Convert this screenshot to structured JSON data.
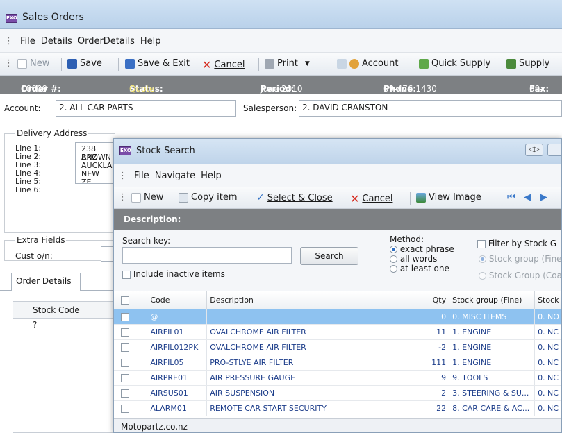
{
  "main": {
    "title": "Sales Orders",
    "app_icon_text": "EXO",
    "menu": [
      "File",
      "Details",
      "OrderDetails",
      "Help"
    ],
    "toolbar": {
      "new": "New",
      "save": "Save",
      "save_exit": "Save & Exit",
      "cancel": "Cancel",
      "print": "Print",
      "account": "Account",
      "quick_supply": "Quick Supply",
      "supply": "Supply"
    },
    "status": {
      "order_label": "Order #:",
      "order_value": "10009",
      "status_label": "Status:",
      "status_value": "Quote",
      "period_label": "Period:",
      "period_value": "June 2010",
      "phone_label": "Phone:",
      "phone_value": "09-476 1430",
      "fax_label": "Fax:",
      "fax_value": "09-"
    },
    "account_label": "Account:",
    "account_value": "2. ALL CAR PARTS",
    "salesperson_label": "Salesperson:",
    "salesperson_value": "2. DAVID CRANSTON",
    "delivery_title": "Delivery Address",
    "delivery_lines": {
      "l1": "Line 1:",
      "l2": "Line 2:",
      "l3": "Line 3:",
      "l4": "Line 4:",
      "l5": "Line 5:",
      "l6": "Line 6:",
      "v1": "238 ANZ",
      "v2": "BROWN",
      "v3": "AUCKLA",
      "v4": "NEW ZE"
    },
    "extra_title": "Extra Fields",
    "cust_label": "Cust o/n:",
    "tab_order_details": "Order Details",
    "grid_header": "Stock Code",
    "grid_row": "?"
  },
  "stock_search": {
    "title": "Stock Search",
    "menu": [
      "File",
      "Navigate",
      "Help"
    ],
    "toolbar": {
      "new": "New",
      "copy_item": "Copy item",
      "select_close": "Select & Close",
      "cancel": "Cancel",
      "view_image": "View Image"
    },
    "description_header": "Description:",
    "search_key_label": "Search key:",
    "search_key_value": "",
    "search_button": "Search",
    "include_inactive": "Include inactive items",
    "method_label": "Method:",
    "method_options": [
      "exact phrase",
      "all words",
      "at least one"
    ],
    "method_selected": "exact phrase",
    "filter_label": "Filter by Stock G",
    "filter_options": [
      "Stock group (Fine",
      "Stock Group (Coa"
    ],
    "columns": [
      "Code",
      "Description",
      "Qty",
      "Stock group (Fine)",
      "Stock"
    ],
    "rows": [
      {
        "code": "@",
        "desc": "",
        "qty": "0",
        "group": "0. MISC ITEMS",
        "stock": "0. NO"
      },
      {
        "code": "AIRFIL01",
        "desc": "OVALCHROME AIR FILTER",
        "qty": "11",
        "group": "1. ENGINE",
        "stock": "0. NC"
      },
      {
        "code": "AIRFIL012PK",
        "desc": "OVALCHROME AIR FILTER",
        "qty": "-2",
        "group": "1. ENGINE",
        "stock": "0. NC"
      },
      {
        "code": "AIRFIL05",
        "desc": "PRO-STLYE AIR FILTER",
        "qty": "111",
        "group": "1. ENGINE",
        "stock": "0. NC"
      },
      {
        "code": "AIRPRE01",
        "desc": "AIR PRESSURE GAUGE",
        "qty": "9",
        "group": "9. TOOLS",
        "stock": "0. NC"
      },
      {
        "code": "AIRSUS01",
        "desc": "AIR SUSPENSION",
        "qty": "2",
        "group": "3. STEERING & SU...",
        "stock": "0. NC"
      },
      {
        "code": "ALARM01",
        "desc": "REMOTE CAR START SECURITY",
        "qty": "22",
        "group": "8. CAR CARE & AC...",
        "stock": "0. NC"
      }
    ],
    "status_text": "Motopartz.co.nz"
  }
}
